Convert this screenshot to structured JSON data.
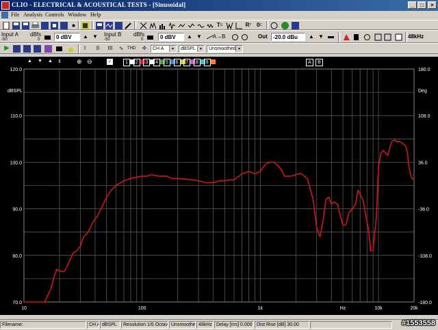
{
  "window": {
    "title": "CLIO - ELECTRICAL & ACOUSTICAL TESTS - [Sinusoidal]",
    "min_glyph": "_",
    "max_glyph": "□",
    "close_glyph": "×"
  },
  "menu": [
    "File",
    "Analysis",
    "Controls",
    "Window",
    "Help"
  ],
  "input_a": {
    "label": "Input A",
    "unit": "dBfs",
    "scale_left": "-50",
    "scale_right": "0",
    "value": "0 dBV"
  },
  "input_b": {
    "label": "Input B",
    "unit": "dBfs",
    "scale_left": "-50",
    "scale_right": "0",
    "value": "0 dBV"
  },
  "output": {
    "label": "Out",
    "value": "-20.0 dBu"
  },
  "toolbar_glyphs": {
    "ab": "A→B",
    "ts": "T",
    "ts_sub": "S",
    "rt": "R",
    "rt_sub": "T",
    "zero_c": "0",
    "zero_c_sub": "C",
    "help": "?"
  },
  "sample_rate": "48kHz",
  "controls": {
    "play_glyph": "▶",
    "i_glyph": "I",
    "ii_glyph": "II",
    "iii_glyph": "III",
    "wave_glyph": "∿",
    "thd": "THD",
    "channel": "CH A",
    "unit": "dBSPL",
    "smoothing": "Unsmoothed",
    "dropdown_arrow": "▾"
  },
  "graph": {
    "left_unit": "dBSPL",
    "right_unit": "Deg",
    "hz_label": "Hz",
    "memories": [
      "1",
      "2",
      "3",
      "4",
      "5",
      "6",
      "7",
      "8",
      "9"
    ],
    "extra_buttons": [
      "A",
      "B"
    ],
    "nav_glyphs": {
      "up": "▲",
      "down": "▼",
      "updown": "⇕",
      "check": "✓",
      "zoom_in": "⊕",
      "zoom_out": "⊖"
    }
  },
  "status": {
    "filename_label": "Filename:",
    "channel": "CH A",
    "unit": "dBSPL",
    "resolution": "Resolution 1/6 Octave",
    "smoothing": "Unsmoothed",
    "rate": "48kHz",
    "delay": "Delay [ms] 0.000",
    "dist_rise": "Dist Rise [dB] 30.00"
  },
  "watermark": "#1553558",
  "colors": {
    "curve": "#d01818",
    "grid": "#5a5a5a",
    "background": "#000000",
    "axis_text": "#ffffff"
  },
  "chart_data": {
    "type": "line",
    "title": "",
    "xlabel": "Hz",
    "ylabel": "dBSPL",
    "y2label": "Deg",
    "x_scale": "log",
    "xlim": [
      10,
      20000
    ],
    "ylim": [
      70,
      120
    ],
    "y2lim": [
      -180,
      180
    ],
    "grid": true,
    "x_tick_labels": [
      "10",
      "100",
      "1k",
      "Hz",
      "10k",
      "20k"
    ],
    "x_tick_values": [
      10,
      100,
      1000,
      5000,
      10000,
      20000
    ],
    "y_ticks": [
      "70.0",
      "80.0",
      "90.0",
      "100.0",
      "110.0",
      "120.0"
    ],
    "y_tick_values": [
      70,
      80,
      90,
      100,
      110,
      120
    ],
    "y2_ticks": [
      "-180.0",
      "-108.0",
      "-36.0",
      "36.0",
      "108.0",
      "180.0"
    ],
    "y2_tick_values": [
      -180,
      -108,
      -36,
      36,
      108,
      180
    ],
    "series": [
      {
        "x": [
          10,
          15,
          17,
          18,
          19,
          20,
          22,
          24,
          26,
          28,
          30,
          32,
          35,
          38,
          42,
          46,
          50,
          55,
          60,
          65,
          70,
          80,
          90,
          100,
          110,
          120,
          140,
          160,
          180,
          200,
          250,
          300,
          350,
          400,
          450,
          500,
          550,
          600,
          700,
          800,
          900,
          1000,
          1100,
          1200,
          1300,
          1400,
          1500,
          1600,
          1800,
          2000,
          2200,
          2500,
          2800,
          3000,
          3200,
          3400,
          3600,
          3800,
          4000,
          4200,
          4500,
          4700,
          5000,
          5300,
          5600,
          6000,
          6400,
          6700,
          7000,
          7400,
          7800,
          8200,
          8600,
          9000,
          9300,
          9600,
          10000,
          10500,
          11000,
          11500,
          12000,
          12600,
          13000,
          13800,
          14400,
          15000,
          16000,
          17000,
          17600,
          18000,
          18600,
          19200,
          20000
        ],
        "y": [
          70,
          70,
          73,
          75.5,
          77,
          76.6,
          76.5,
          78.5,
          80.5,
          81,
          82,
          84,
          85,
          87,
          88.5,
          90.5,
          92.5,
          94,
          95,
          95.5,
          96,
          96.5,
          96.8,
          97,
          97,
          97.3,
          97,
          97,
          96.5,
          96.5,
          96.3,
          96,
          95.6,
          95.6,
          96,
          96,
          96.2,
          96.2,
          97.5,
          98,
          97.5,
          98,
          99.5,
          100,
          100,
          99.3,
          98.5,
          97,
          97,
          97.3,
          97.6,
          96.5,
          92,
          86,
          84,
          87.5,
          92,
          92.5,
          91,
          91.5,
          91,
          89,
          86.5,
          86.5,
          89,
          90,
          91,
          94,
          93,
          92,
          88.5,
          86,
          81,
          81,
          85,
          88,
          99,
          102,
          102.5,
          102,
          101.5,
          103.5,
          104.5,
          104.8,
          104.3,
          104.5,
          104,
          103.5,
          102,
          99.5,
          97.5,
          96.5,
          96.5
        ]
      }
    ]
  }
}
